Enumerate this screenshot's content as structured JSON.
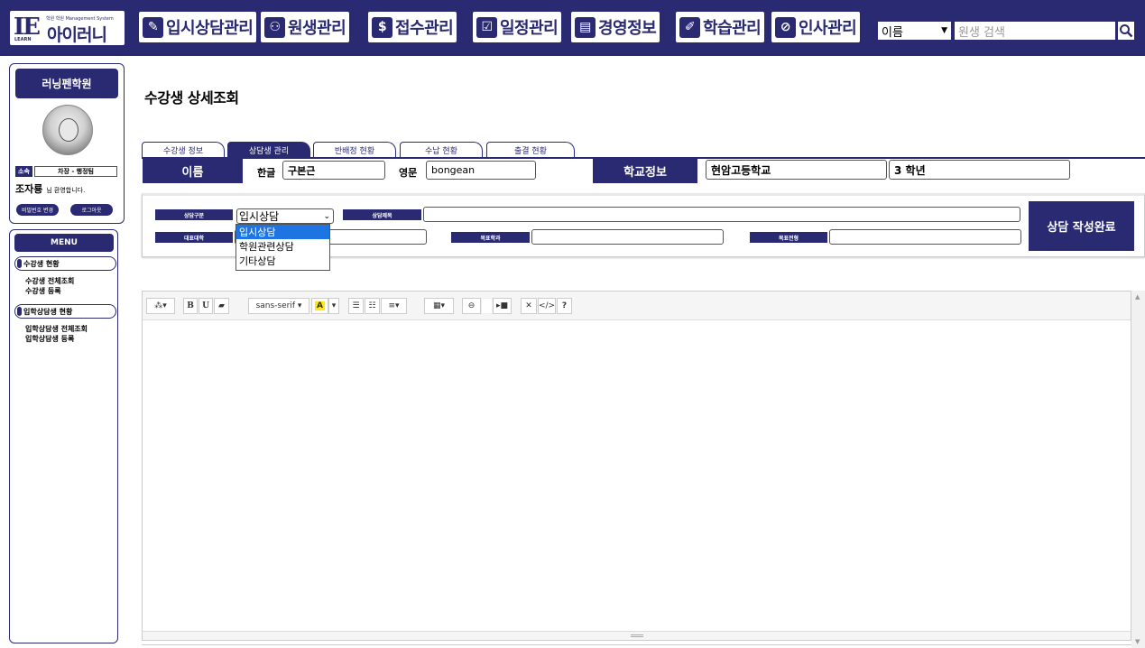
{
  "brand": {
    "mark": "IE",
    "learn": "LEARN",
    "subtitle": "학원 학원 Management System",
    "name": "아이러니"
  },
  "nav": [
    {
      "label": "입시상담관리",
      "icon": "pencil-icon",
      "glyph": "✎"
    },
    {
      "label": "원생관리",
      "icon": "person-icon",
      "glyph": "⚇"
    },
    {
      "label": "접수관리",
      "icon": "dollar-icon",
      "glyph": "$"
    },
    {
      "label": "일정관리",
      "icon": "checkbox-icon",
      "glyph": "☑"
    },
    {
      "label": "경영정보",
      "icon": "document-icon",
      "glyph": "▤"
    },
    {
      "label": "학습관리",
      "icon": "edit-icon",
      "glyph": "✐"
    },
    {
      "label": "인사관리",
      "icon": "tag-icon",
      "glyph": "⊘"
    }
  ],
  "search": {
    "type_value": "이름",
    "placeholder": "원생 검색"
  },
  "profile": {
    "academy": "러닝펜학원",
    "affil_label": "소속",
    "affil_value": "차장 - 행정팀",
    "user_name": "조자룡",
    "welcome_suffix": "님 환영합니다.",
    "change_pw": "비밀번호 변경",
    "logout": "로그아웃"
  },
  "menu": {
    "header": "MENU",
    "groups": [
      {
        "label": "수강생 현황",
        "items": [
          "수강생 전체조회",
          "수강생 등록"
        ]
      },
      {
        "label": "입학상담생 현황",
        "items": [
          "입학상담생 전체조회",
          "입학상담생 등록"
        ]
      }
    ]
  },
  "page_title": "수강생 상세조회",
  "tabs": [
    "수강생 정보",
    "상담생 관리",
    "반배정 현황",
    "수납 현황",
    "출결 현황"
  ],
  "student": {
    "name_label": "이름",
    "korean_label": "한글",
    "korean_value": "구본근",
    "english_label": "영문",
    "english_value": "bongean",
    "school_label": "학교정보",
    "school_value": "현암고등학교",
    "grade_value": "3 학년"
  },
  "consult": {
    "type_label": "상담구분",
    "type_value": "입시상담",
    "type_options": [
      "입시상담",
      "학원관련상담",
      "기타상담"
    ],
    "title_label": "상담제목",
    "univ_label": "대표대학",
    "dept_label": "목표학과",
    "grade_label": "목표전형",
    "save_button": "상담 작성완료"
  },
  "editor": {
    "font_name": "sans-serif",
    "bold": "B",
    "underline": "U",
    "help": "?",
    "code": "</>"
  },
  "colors": {
    "primary": "#2a2a73",
    "highlight": "#1e74e3"
  }
}
